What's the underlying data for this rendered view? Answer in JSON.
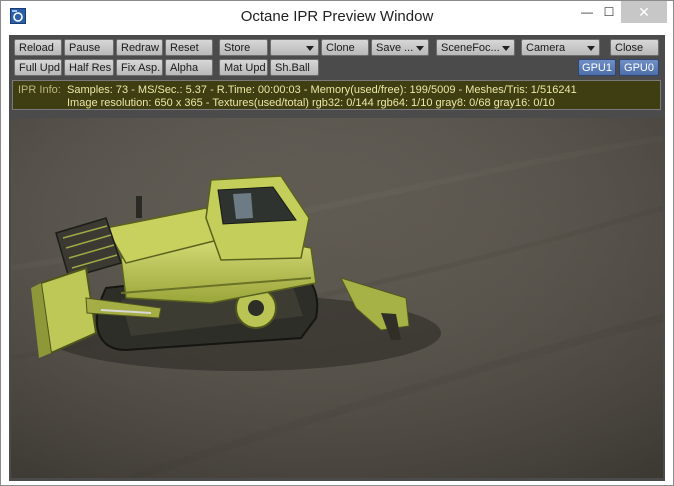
{
  "window": {
    "title": "Octane IPR Preview Window",
    "minimize_glyph": "—",
    "maximize_glyph": "☐",
    "close_glyph": "✕",
    "icon": "octane-app-icon"
  },
  "toolbar": {
    "reload": "Reload",
    "pause": "Pause",
    "redraw": "Redraw",
    "reset": "Reset",
    "store": "Store",
    "store_select": "",
    "clone": "Clone",
    "save": "Save ...",
    "scene_focus": "SceneFoc...",
    "camera": "Camera",
    "close": "Close",
    "full_upd": "Full Upd.",
    "half_res": "Half Res",
    "fix_asp": "Fix Asp.",
    "alpha": "Alpha",
    "mat_upd": "Mat Upd",
    "sh_ball": "Sh.Ball",
    "gpu1": "GPU1",
    "gpu0": "GPU0"
  },
  "ipr_info": {
    "label": "IPR Info:",
    "line1": "Samples: 73  -  MS/Sec.: 5.37  -  R.Time: 00:00:03 - Memory(used/free): 199/5009  -  Meshes/Tris: 1/516241",
    "line2": "Image resolution: 650 x 365 - Textures(used/total) rgb32: 0/144  rgb64: 1/10  gray8: 0/68  gray16: 0/10"
  },
  "render": {
    "subject": "yellow-bulldozer",
    "colors": {
      "ground": "#5d5850",
      "body": "#c9d35a",
      "body_shadow": "#7f8a2c",
      "track": "#2e2e28"
    }
  }
}
